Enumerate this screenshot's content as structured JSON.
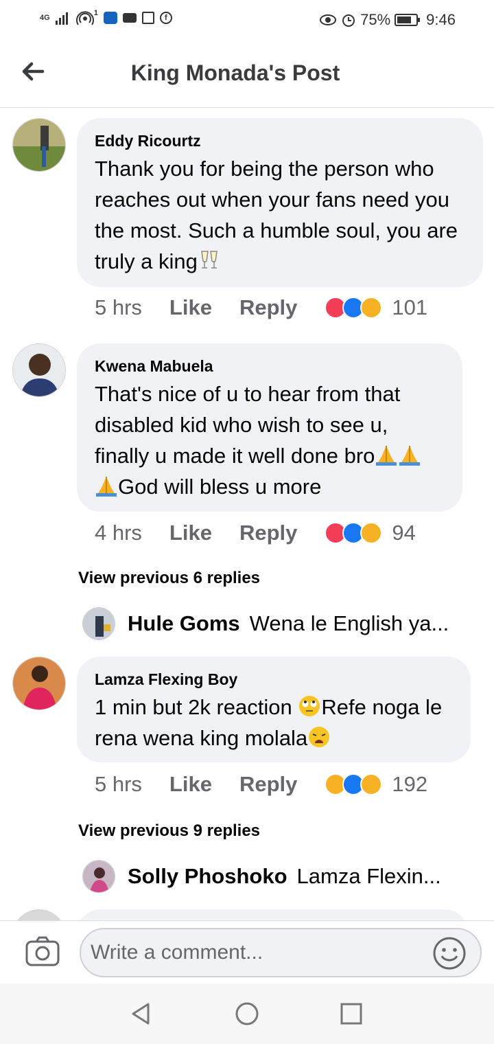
{
  "status_bar": {
    "signal_text": "4G",
    "notif_badge": "1",
    "battery": "75%",
    "battery_level": 0.75,
    "time": "9:46"
  },
  "header": {
    "title": "King Monada's Post",
    "back_icon": "arrow-left-icon"
  },
  "comments": [
    {
      "author": "Eddy Ricourtz",
      "text": "Thank you for being the person who reaches out when your fans need you the most. Such a humble soul, you are truly a king",
      "trailing_emoji": "clinking-glasses-icon",
      "time": "5 hrs",
      "like_label": "Like",
      "reply_label": "Reply",
      "reactions": [
        "love",
        "like",
        "wow"
      ],
      "reaction_count": "101"
    },
    {
      "author": "Kwena Mabuela",
      "text_before": "That's nice of u to hear from that disabled kid who wish to see u, finally u made it well done bro",
      "emoji": "folded-hands-icon",
      "text_after": "God will bless u more",
      "time": "4 hrs",
      "like_label": "Like",
      "reply_label": "Reply",
      "reactions": [
        "love",
        "like",
        "wow"
      ],
      "reaction_count": "94",
      "view_previous": "View previous 6 replies",
      "latest_reply": {
        "name": "Hule Goms",
        "text": "Wena le English ya..."
      }
    },
    {
      "author": "Lamza Flexing Boy",
      "text_1": "1 min but 2k reaction",
      "emoji_1": "rolling-eyes-icon",
      "text_2": "Refe noga le rena wena king molala",
      "emoji_2": "weary-face-icon",
      "time": "5 hrs",
      "like_label": "Like",
      "reply_label": "Reply",
      "reactions": [
        "haha",
        "like",
        "wow"
      ],
      "reaction_count": "192",
      "view_previous": "View previous 9 replies",
      "latest_reply": {
        "name": "Solly Phoshoko",
        "text": "Lamza Flexin..."
      }
    }
  ],
  "composer": {
    "placeholder": "Write a comment...",
    "camera_icon": "camera-icon",
    "emoji_icon": "smiley-icon"
  },
  "nav_bar": {
    "back": "nav-back-icon",
    "home": "nav-home-icon",
    "recents": "nav-recents-icon"
  },
  "colors": {
    "bubble": "#f0f2f5",
    "secondary_text": "#65676b",
    "love": "#f33e58",
    "like": "#1877f2",
    "wow": "#f7b125"
  }
}
